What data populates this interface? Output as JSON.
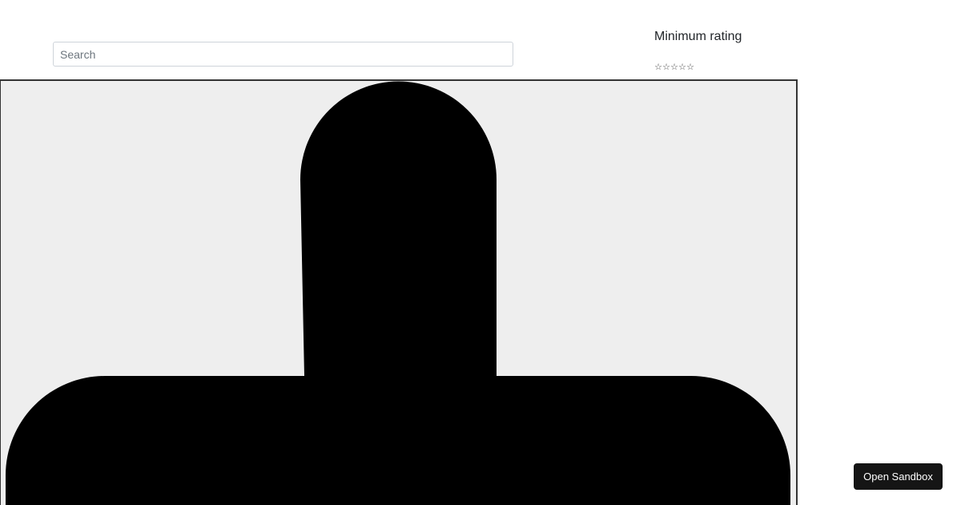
{
  "search": {
    "placeholder": "Search",
    "value": ""
  },
  "rating_filter": {
    "label": "Minimum rating",
    "stars": [
      "☆",
      "☆",
      "☆",
      "☆",
      "☆"
    ],
    "selected": 0
  },
  "product": {
    "image_background": "#eeeeee",
    "shape_color": "#000000"
  },
  "sandbox": {
    "label": "Open Sandbox"
  },
  "colors": {
    "button_bg": "#151515",
    "button_text": "#ffffff"
  }
}
